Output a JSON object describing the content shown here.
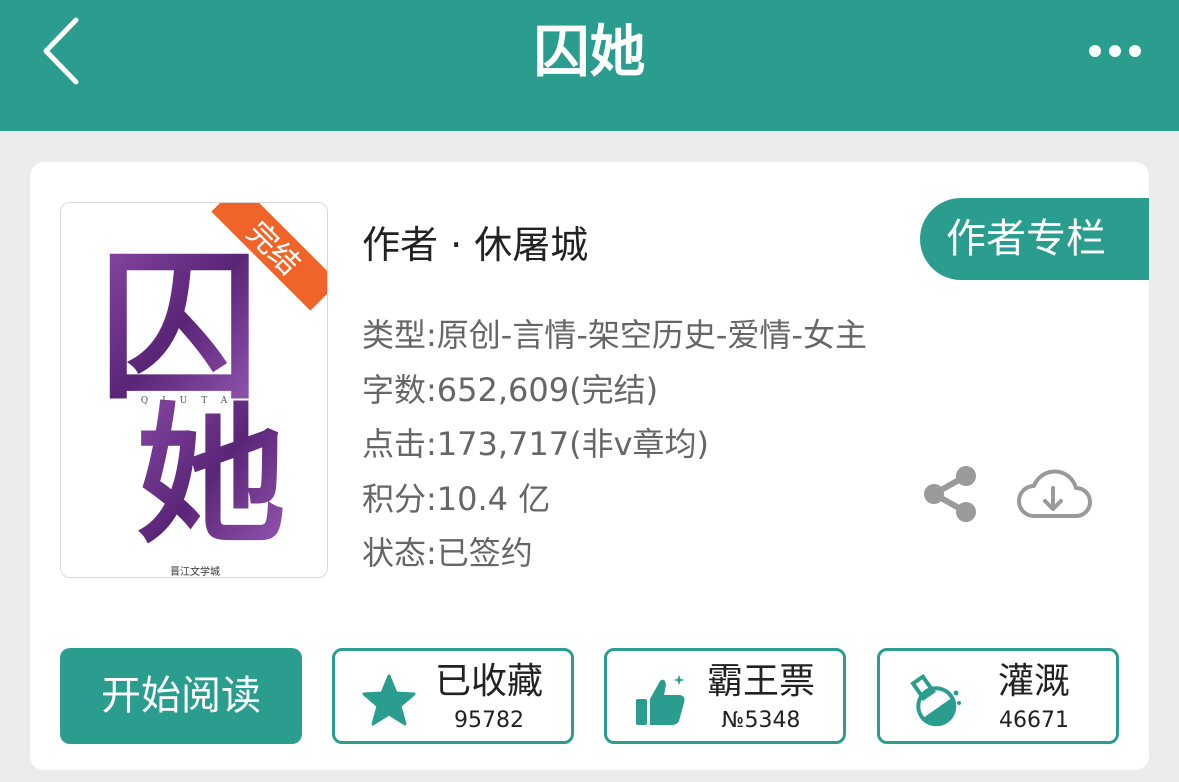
{
  "nav": {
    "title": "囚她",
    "back_icon": "chevron-left-icon",
    "more_icon": "more-dots-icon"
  },
  "book": {
    "cover": {
      "title_art": "囚她",
      "badge": "完结",
      "subtitle": "QIUTA",
      "publisher": "晋江文学城"
    },
    "author_line": "作者 · 休屠城",
    "author_column_label": "作者专栏",
    "meta": {
      "type": "类型:原创-言情-架空历史-爱情-女主",
      "word_count": "字数:652,609(完结)",
      "clicks": "点击:173,717(非v章均)",
      "score": "积分:10.4 亿",
      "status": "状态:已签约"
    }
  },
  "actions": {
    "start_reading": "开始阅读",
    "collect": {
      "label": "已收藏",
      "count": "95782",
      "icon": "star-icon"
    },
    "ticket": {
      "label": "霸王票",
      "count": "№5348",
      "icon": "thumbs-up-icon"
    },
    "water": {
      "label": "灌溉",
      "count": "46671",
      "icon": "flask-icon"
    }
  },
  "icons": {
    "share": "share-icon",
    "download": "cloud-download-icon"
  },
  "colors": {
    "accent": "#2a9d8f",
    "badge": "#f0642a",
    "cover_purple": "#6b2f8a"
  }
}
